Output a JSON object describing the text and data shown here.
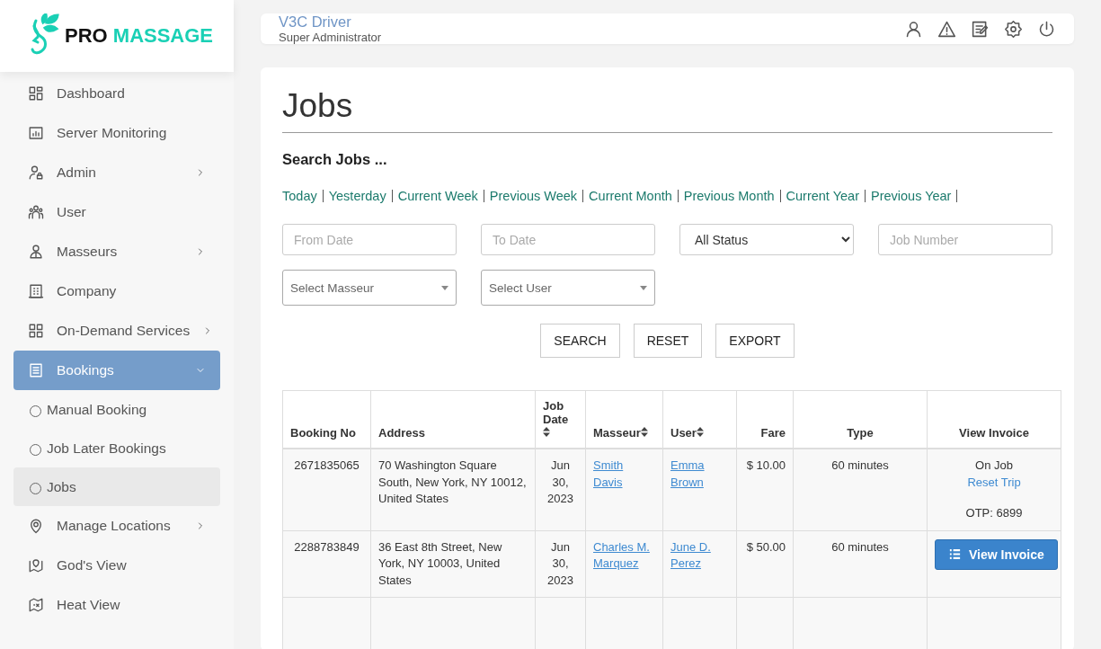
{
  "logo": {
    "brand_dark": "PRO",
    "brand_accent": "MASSAGE"
  },
  "sidebar": {
    "items": [
      {
        "label": "Dashboard",
        "has_submenu": false
      },
      {
        "label": "Server Monitoring",
        "has_submenu": false
      },
      {
        "label": "Admin",
        "has_submenu": true
      },
      {
        "label": "User",
        "has_submenu": false
      },
      {
        "label": "Masseurs",
        "has_submenu": true
      },
      {
        "label": "Company",
        "has_submenu": false
      },
      {
        "label": "On-Demand Services",
        "has_submenu": true
      },
      {
        "label": "Bookings",
        "has_submenu": true,
        "expanded": true,
        "selected": true,
        "children": [
          {
            "label": "Manual Booking",
            "selected": false
          },
          {
            "label": "Job Later Bookings",
            "selected": false
          },
          {
            "label": "Jobs",
            "selected": true
          }
        ]
      },
      {
        "label": "Manage Locations",
        "has_submenu": true
      },
      {
        "label": "God's View",
        "has_submenu": false
      },
      {
        "label": "Heat View",
        "has_submenu": false
      }
    ]
  },
  "header": {
    "user_name": "V3C Driver",
    "role": "Super Administrator"
  },
  "page": {
    "title": "Jobs",
    "search_heading": "Search Jobs ...",
    "quick_ranges": [
      "Today",
      "Yesterday",
      "Current Week",
      "Previous Week",
      "Current Month",
      "Previous Month",
      "Current Year",
      "Previous Year"
    ],
    "filters": [
      {
        "kind": "input",
        "placeholder": "From Date"
      },
      {
        "kind": "input",
        "placeholder": "To Date"
      },
      {
        "kind": "select",
        "value": "All Status"
      },
      {
        "kind": "input",
        "placeholder": "Job Number"
      },
      {
        "kind": "combo",
        "placeholder": "Select Masseur"
      },
      {
        "kind": "combo",
        "placeholder": "Select User"
      }
    ],
    "buttons": [
      "SEARCH",
      "RESET",
      "EXPORT"
    ]
  },
  "table": {
    "columns": [
      {
        "label": "Booking No",
        "sortable": false
      },
      {
        "label": "Address",
        "sortable": false
      },
      {
        "label": "Job Date",
        "sortable": true
      },
      {
        "label": "Masseur",
        "sortable": true
      },
      {
        "label": "User",
        "sortable": true
      },
      {
        "label": "Fare",
        "sortable": false
      },
      {
        "label": "Type",
        "sortable": false
      },
      {
        "label": "View Invoice",
        "sortable": false
      }
    ],
    "rows": [
      {
        "booking_no": "2671835065",
        "address": "70 Washington Square South, New York, NY 10012, United States",
        "job_date": "Jun 30, 2023",
        "masseur": "Smith Davis",
        "user": "Emma Brown",
        "fare": "$ 10.00",
        "type": "60 minutes",
        "invoice": {
          "kind": "status",
          "status": "On Job",
          "link": "Reset Trip",
          "otp": "OTP: 6899"
        }
      },
      {
        "booking_no": "2288783849",
        "address": "36 East 8th Street, New York, NY 10003, United States",
        "job_date": "Jun 30, 2023",
        "masseur": "Charles M. Marquez",
        "user": "June D. Perez",
        "fare": "$ 50.00",
        "type": "60 minutes",
        "invoice": {
          "kind": "button",
          "label": "View Invoice"
        }
      }
    ]
  }
}
